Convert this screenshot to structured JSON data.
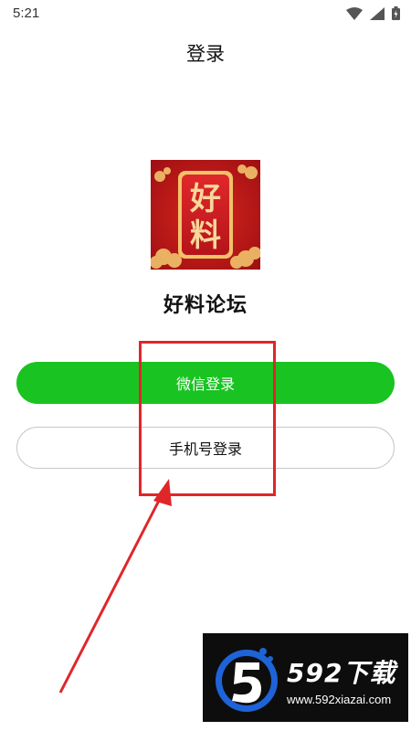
{
  "status_bar": {
    "time": "5:21",
    "icons": [
      "wifi-icon",
      "signal-icon",
      "battery-icon"
    ]
  },
  "header": {
    "title": "登录"
  },
  "app": {
    "logo_text": [
      "好",
      "料"
    ],
    "name": "好料论坛"
  },
  "actions": {
    "wechat_login": "微信登录",
    "phone_login": "手机号登录"
  },
  "watermark": {
    "title": "592下载",
    "url": "www.592xiazai.com"
  },
  "colors": {
    "wechat_green": "#19c321",
    "annotation_red": "#e0262a",
    "logo_red": "#c4161c",
    "logo_gold": "#f2c26b"
  }
}
